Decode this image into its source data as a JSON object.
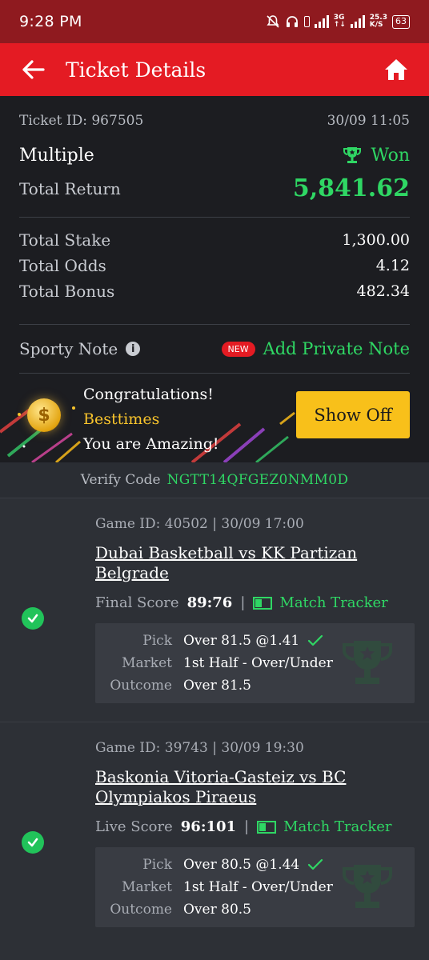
{
  "status_bar": {
    "time": "9:28 PM",
    "net_type": "3G",
    "speed_value": "25.3",
    "speed_unit": "K/S",
    "battery": "63"
  },
  "app_bar": {
    "title": "Ticket Details"
  },
  "ticket": {
    "id_label": "Ticket ID: 967505",
    "datetime": "30/09 11:05",
    "type": "Multiple",
    "status": "Won",
    "total_return_label": "Total Return",
    "total_return": "5,841.62",
    "stats": [
      {
        "label": "Total Stake",
        "value": "1,300.00"
      },
      {
        "label": "Total Odds",
        "value": "4.12"
      },
      {
        "label": "Total Bonus",
        "value": "482.34"
      }
    ],
    "note_label": "Sporty Note",
    "new_badge": "NEW",
    "add_note": "Add Private Note"
  },
  "banner": {
    "line1": "Congratulations!",
    "username": "Besttimes",
    "line3": "You are Amazing!",
    "button": "Show Off"
  },
  "verify": {
    "label": "Verify Code",
    "code": "NGTT14QFGEZ0NMM0D"
  },
  "games": [
    {
      "meta": "Game ID: 40502 | 30/09 17:00",
      "title": "Dubai Basketball vs KK Partizan Belgrade",
      "score_label": "Final Score",
      "score": "89:76",
      "tracker": "Match Tracker",
      "pick_label": "Pick",
      "pick": "Over 81.5 @1.41",
      "market_label": "Market",
      "market": "1st Half - Over/Under",
      "outcome_label": "Outcome",
      "outcome": "Over 81.5"
    },
    {
      "meta": "Game ID: 39743 | 30/09 19:30",
      "title": "Baskonia Vitoria-Gasteiz vs BC Olympiakos Piraeus",
      "score_label": "Live Score",
      "score": "96:101",
      "tracker": "Match Tracker",
      "pick_label": "Pick",
      "pick": "Over 80.5 @1.44",
      "market_label": "Market",
      "market": "1st Half - Over/Under",
      "outcome_label": "Outcome",
      "outcome": "Over 80.5"
    }
  ],
  "colors": {
    "brand_red": "#e41b23",
    "status_red": "#8f1a1f",
    "win_green": "#2fd764",
    "gold": "#f8c01a"
  }
}
